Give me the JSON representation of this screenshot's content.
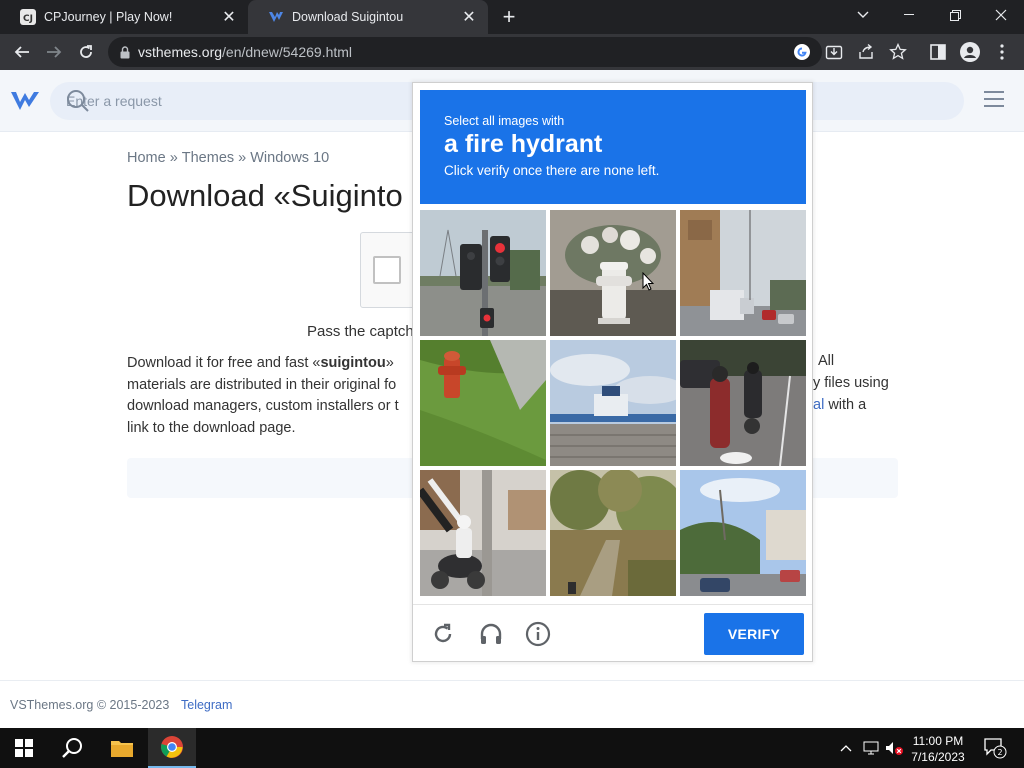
{
  "browser": {
    "tabs": [
      {
        "title": "CPJourney | Play Now!",
        "favicon": "cpjourney-favicon"
      },
      {
        "title": "Download Suigintou",
        "favicon": "vsthemes-favicon",
        "active": true
      }
    ],
    "url_host": "vsthemes.org",
    "url_path": "/en/dnew/54269.html"
  },
  "site": {
    "search_placeholder": "Enter a request",
    "breadcrumbs": [
      "Home",
      "Themes",
      "Windows 10"
    ],
    "breadcrumb_sep": "»",
    "page_title": "Download «Suiginto",
    "pass_text": "Pass the captch",
    "description_line1_start": "Download it for free and fast «",
    "description_bold": "suigintou",
    "description_line1_end": "»",
    "description_line2": "materials are distributed in their original fo",
    "description_line3": "download managers, custom installers or t",
    "description_line4": "link to the download page.",
    "desc_right_all": "All",
    "desc_right_files": "y files using",
    "desc_right_link": "al",
    "desc_right_with": " with a",
    "footer_copy": "VSThemes.org © 2015-2023",
    "footer_telegram": "Telegram"
  },
  "captcha": {
    "instruction_small": "Select all images with",
    "target": "a fire hydrant",
    "instruction_sub": "Click verify once there are none left.",
    "verify_label": "VERIFY",
    "header_color": "#1a73e8",
    "tiles": [
      {
        "content": "traffic-light"
      },
      {
        "content": "white-fire-hydrant"
      },
      {
        "content": "street-with-truck"
      },
      {
        "content": "red-fire-hydrant-on-grass"
      },
      {
        "content": "rooftop-with-boat"
      },
      {
        "content": "motorcycles-on-road"
      },
      {
        "content": "scooter-rider-at-pole"
      },
      {
        "content": "dirt-path-with-trees"
      },
      {
        "content": "hillside-street"
      }
    ]
  },
  "taskbar": {
    "time": "11:00 PM",
    "date": "7/16/2023",
    "notification_count": "2"
  }
}
